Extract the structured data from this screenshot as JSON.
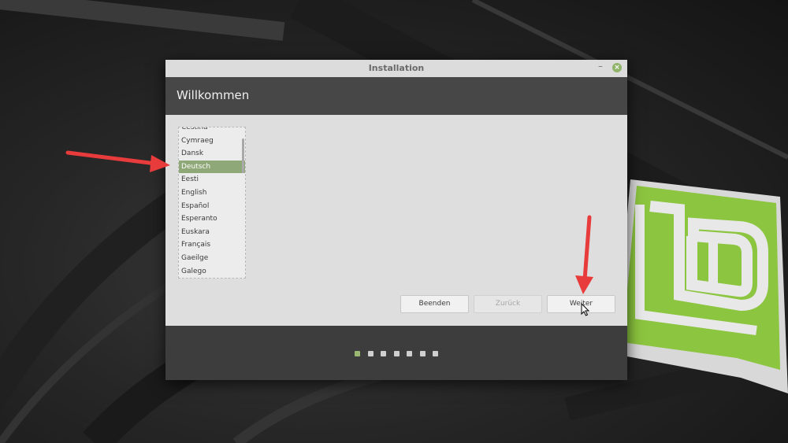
{
  "window": {
    "title": "Installation",
    "minimize_glyph": "–",
    "close_glyph": "×",
    "header_title": "Willkommen"
  },
  "languages": {
    "items": [
      "Čeština",
      "Cymraeg",
      "Dansk",
      "Deutsch",
      "Eesti",
      "English",
      "Español",
      "Esperanto",
      "Euskara",
      "Français",
      "Gaeilge",
      "Galego"
    ],
    "selected": "Deutsch"
  },
  "buttons": {
    "quit": "Beenden",
    "back": "Zurück",
    "next": "Weiter"
  },
  "progress": {
    "total_steps": 7,
    "current_step": 1
  },
  "colors": {
    "accent": "#8fa878",
    "annotation_arrow": "#e83b3b",
    "header_bg": "#474747",
    "mint_logo": "#8cc53f"
  },
  "icons": {
    "close": "close-icon",
    "minimize": "minimize-icon",
    "cursor": "mouse-pointer-icon",
    "logo": "linux-mint-logo"
  }
}
